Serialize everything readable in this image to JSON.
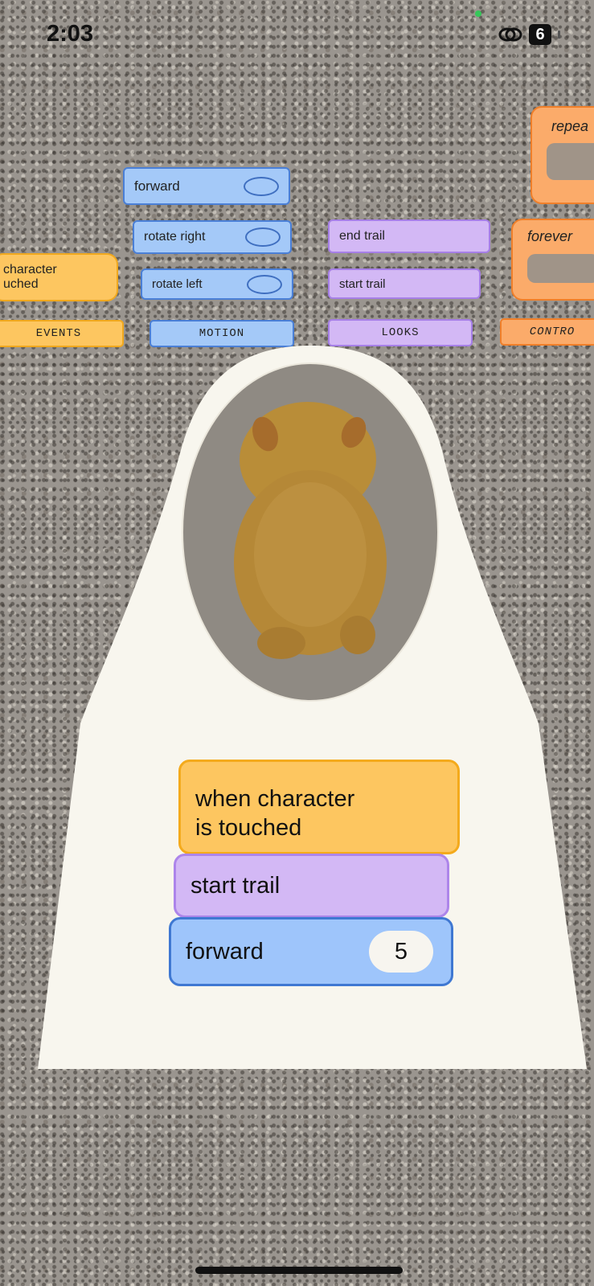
{
  "status_bar": {
    "time": "2:03",
    "battery_level": "6"
  },
  "palette": {
    "motion_blocks": [
      {
        "label": "forward"
      },
      {
        "label": "rotate right"
      },
      {
        "label": "rotate left"
      }
    ],
    "looks_blocks": [
      {
        "label": "end trail"
      },
      {
        "label": "start trail"
      }
    ],
    "events_block": {
      "label_line1": "character",
      "label_line2": "uched"
    },
    "control_blocks": [
      {
        "label": "repea"
      },
      {
        "label": "forever"
      }
    ],
    "categories": {
      "events": "EVENTS",
      "motion": "MOTION",
      "looks": "LOOKS",
      "control": "CONTRO"
    }
  },
  "stage": {
    "character": "hamster-character",
    "script": {
      "trigger_line1": "when character",
      "trigger_line2": "is touched",
      "action1": "start trail",
      "action2_label": "forward",
      "action2_value": "5"
    }
  },
  "colors": {
    "motion": "#a4c9f8",
    "looks": "#d3b8f5",
    "events": "#fdc660",
    "control": "#fbab6a",
    "stage": "#f8f6ee"
  }
}
